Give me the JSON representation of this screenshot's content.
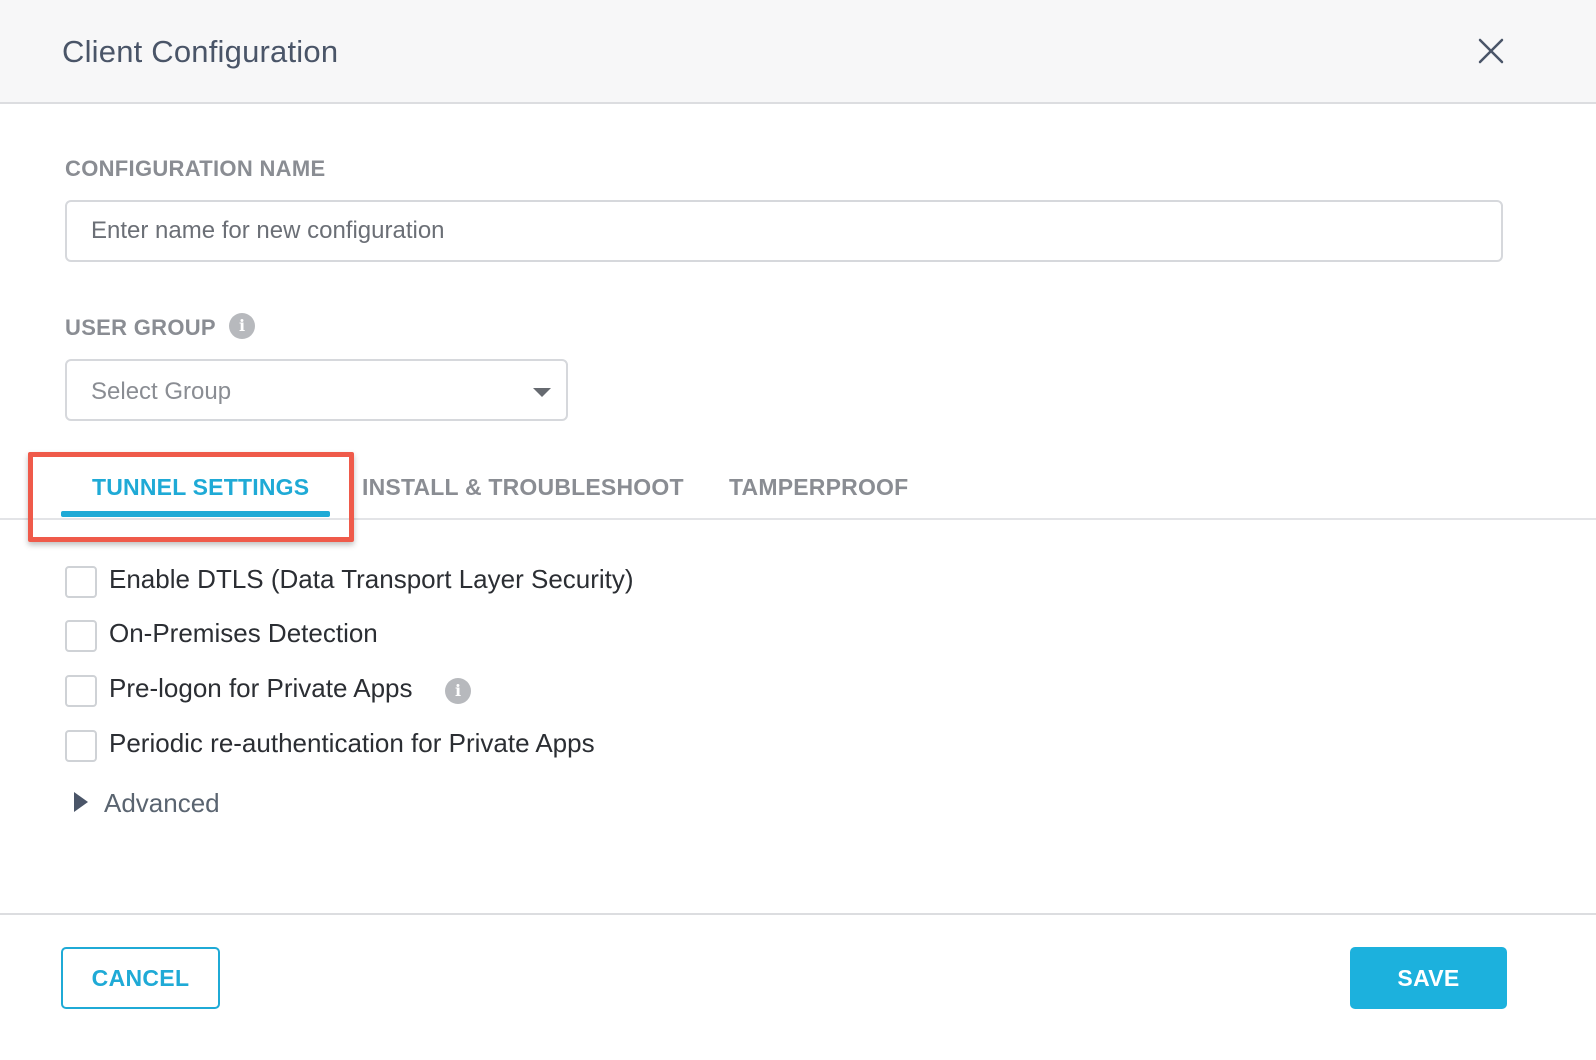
{
  "dialog": {
    "title": "Client Configuration"
  },
  "config_name": {
    "label": "CONFIGURATION NAME",
    "value": "",
    "placeholder": "Enter name for new configuration"
  },
  "user_group": {
    "label": "USER GROUP",
    "info_glyph": "i",
    "selected": "Select Group"
  },
  "tabs": [
    {
      "label": "TUNNEL SETTINGS",
      "active": true
    },
    {
      "label": "INSTALL & TROUBLESHOOT",
      "active": false
    },
    {
      "label": "TAMPERPROOF",
      "active": false
    }
  ],
  "tunnel_settings": {
    "options": [
      {
        "label": "Enable DTLS (Data Transport Layer Security)",
        "checked": false
      },
      {
        "label": "On-Premises Detection",
        "checked": false
      },
      {
        "label": "Pre-logon for Private Apps",
        "checked": false,
        "info_glyph": "i"
      },
      {
        "label": "Periodic re-authentication for Private Apps",
        "checked": false
      }
    ],
    "advanced_label": "Advanced"
  },
  "footer": {
    "cancel_label": "CANCEL",
    "save_label": "SAVE"
  },
  "colors": {
    "accent": "#1faad6",
    "highlight": "#ef5a4a"
  }
}
